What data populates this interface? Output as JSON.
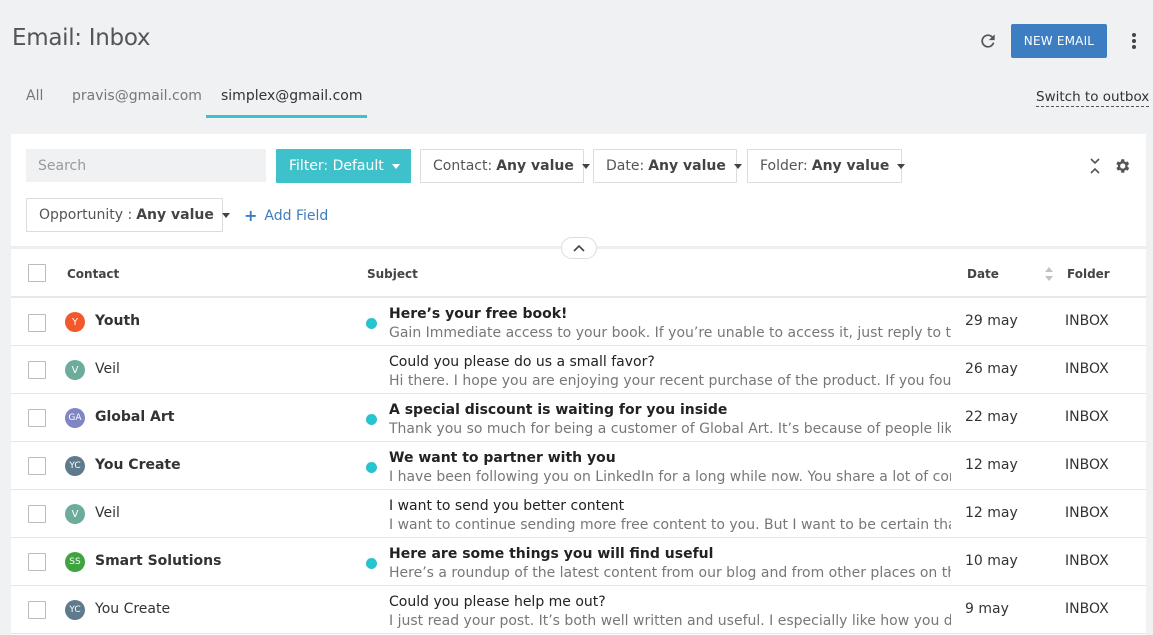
{
  "page": {
    "title": "Email: Inbox",
    "new_email_label": "NEW EMAIL"
  },
  "tabs": [
    {
      "label": "All",
      "active": false
    },
    {
      "label": "pravis@gmail.com",
      "active": false
    },
    {
      "label": "simplex@gmail.com",
      "active": true
    }
  ],
  "switch_link": "Switch to outbox",
  "filters": {
    "search_placeholder": "Search",
    "primary_label": "Filter: Default",
    "contact_label": "Contact:",
    "contact_value": "Any value",
    "date_label": "Date:",
    "date_value": "Any value",
    "folder_label": "Folder:",
    "folder_value": "Any value",
    "opportunity_label": "Opportunity :",
    "opportunity_value": "Any value",
    "add_field_label": "Add Field"
  },
  "table": {
    "headers": {
      "contact": "Contact",
      "subject": "Subject",
      "date": "Date",
      "folder": "Folder"
    },
    "rows": [
      {
        "initials": "Y",
        "avatar_color": "#f2582b",
        "contact": "Youth",
        "unread": true,
        "subject": "Here’s your free book!",
        "snippet": "Gain Immediate access to your book. If you’re unable to access it, just reply to this email",
        "date": "29 may",
        "folder": "INBOX"
      },
      {
        "initials": "V",
        "avatar_color": "#6dab9c",
        "contact": "Veil",
        "unread": false,
        "subject": "Could you please do us a small favor?",
        "snippet": "Hi there. I hope you are enjoying your recent purchase of the product. If you found it useful",
        "date": "26 may",
        "folder": "INBOX"
      },
      {
        "initials": "GA",
        "avatar_color": "#7f86c6",
        "contact": "Global Art",
        "unread": true,
        "subject": "A special discount is waiting for you inside",
        "snippet": "Thank you so much for being a customer of Global Art. It’s because of people like you we",
        "date": "22 may",
        "folder": "INBOX"
      },
      {
        "initials": "YC",
        "avatar_color": "#5f7a8a",
        "contact": "You Create",
        "unread": true,
        "subject": "We want to partner with you",
        "snippet": "I have been following you on LinkedIn for a long while now. You share a lot of content,",
        "date": "12 may",
        "folder": "INBOX"
      },
      {
        "initials": "V",
        "avatar_color": "#6dab9c",
        "contact": "Veil",
        "unread": false,
        "subject": "I want to send you better content",
        "snippet": "I want to continue sending more free content to you. But I want to be certain that I am",
        "date": "12 may",
        "folder": "INBOX"
      },
      {
        "initials": "SS",
        "avatar_color": "#3fa33f",
        "contact": "Smart Solutions",
        "unread": true,
        "subject": "Here are some things you will find useful",
        "snippet": "Here’s a roundup of the latest content from our blog and from other places on the web",
        "date": "10 may",
        "folder": "INBOX"
      },
      {
        "initials": "YC",
        "avatar_color": "#5f7a8a",
        "contact": "You Create",
        "unread": false,
        "subject": "Could you please help me out?",
        "snippet": "I just read your post. It’s both well written and useful. I especially like how you describe",
        "date": "9 may",
        "folder": "INBOX"
      }
    ]
  }
}
